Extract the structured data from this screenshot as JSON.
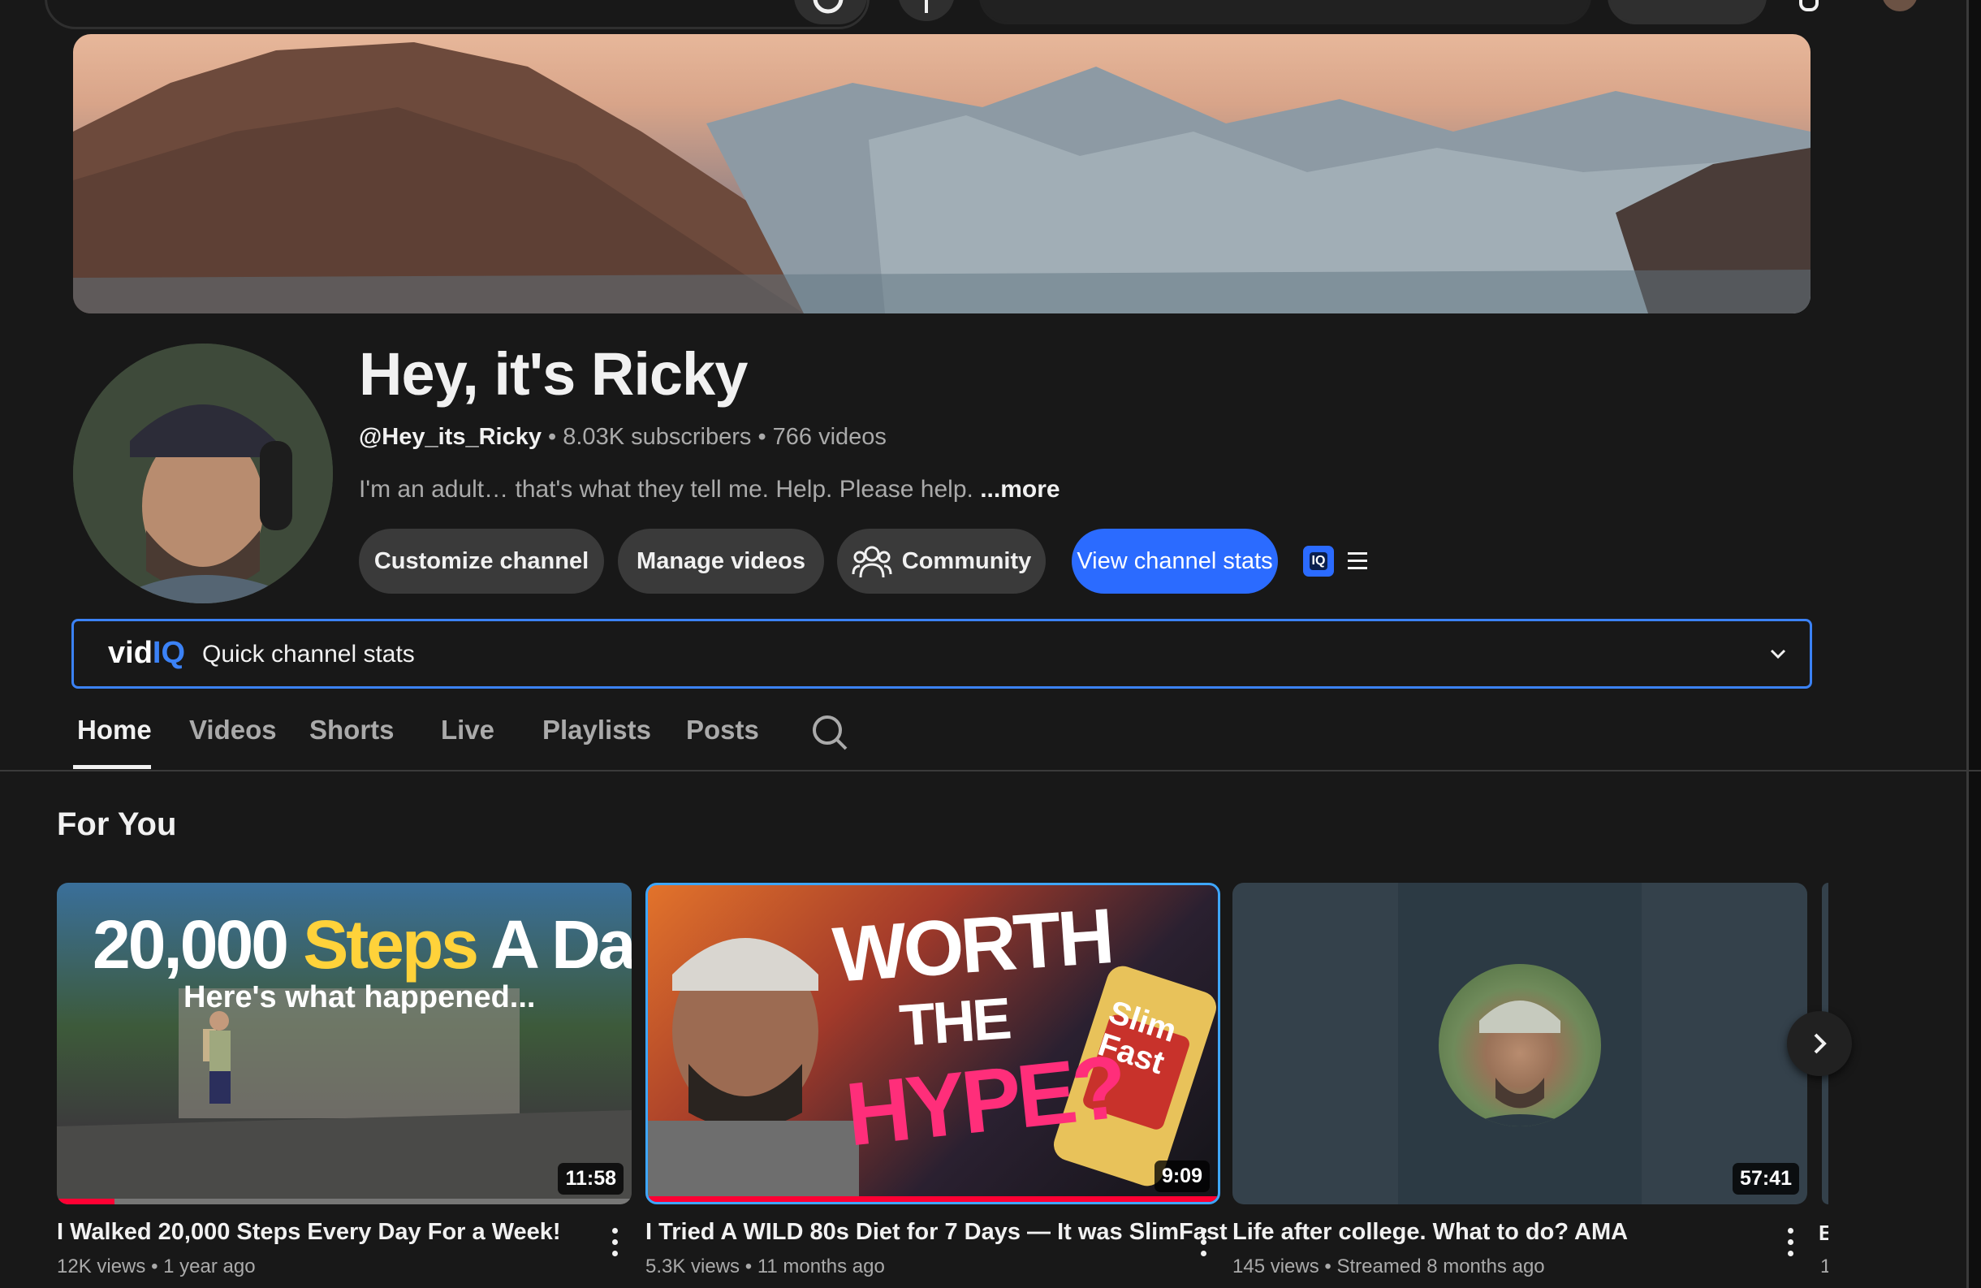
{
  "channel": {
    "name": "Hey, it's Ricky",
    "handle": "@Hey_its_Ricky",
    "subscribers": "8.03K subscribers",
    "videos": "766 videos",
    "separator": "•",
    "description": "I'm an adult… that's what they tell me. Help. Please help.",
    "more_label": "...more"
  },
  "actions": {
    "customize": "Customize channel",
    "manage": "Manage videos",
    "community": "Community",
    "stats": "View channel stats"
  },
  "vidiq": {
    "logo_vid": "vid",
    "logo_iq": "IQ",
    "label": "Quick channel stats",
    "badge": "IQ"
  },
  "tabs": [
    "Home",
    "Videos",
    "Shorts",
    "Live",
    "Playlists",
    "Posts"
  ],
  "active_tab": "Home",
  "section_title": "For You",
  "videos": [
    {
      "title": "I Walked 20,000 Steps Every Day For a Week!",
      "views": "12K views",
      "age": "1 year ago",
      "duration": "11:58",
      "thumb_line1_a": "20,000",
      "thumb_line1_b": "Steps",
      "thumb_line1_c": "A Day",
      "thumb_line2": "Here's what happened...",
      "watched_fraction": 0.1
    },
    {
      "title": "I Tried A WILD 80s Diet for 7 Days — It was SlimFast",
      "views": "5.3K views",
      "age": "11 months ago",
      "duration": "9:09",
      "thumb_worth": "WORTH",
      "thumb_the": "THE",
      "thumb_hype": "HYPE?",
      "thumb_can": "Slim Fast",
      "watched_fraction": 1.0
    },
    {
      "title": "Life after college. What to do? AMA",
      "views": "145 views",
      "age": "Streamed 8 months ago",
      "duration": "57:41"
    }
  ],
  "partial_next": {
    "title": "E",
    "meta": "1"
  },
  "colors": {
    "background": "#181818",
    "accent_blue": "#2b6bff",
    "vidiq_blue": "#3b82f6",
    "progress_red": "#ff0033"
  }
}
